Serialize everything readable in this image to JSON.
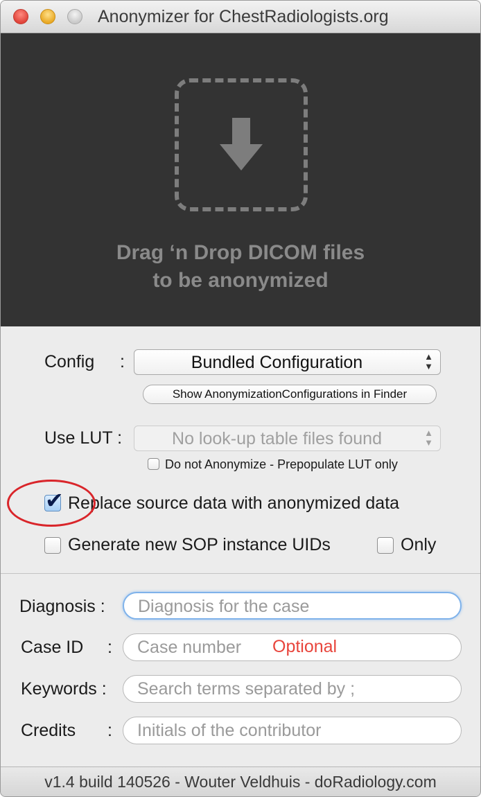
{
  "window": {
    "title": "Anonymizer for ChestRadiologists.org"
  },
  "dropzone": {
    "line1": "Drag ‘n Drop DICOM files",
    "line2": "to be anonymized",
    "icon": "download-arrow-icon"
  },
  "config": {
    "label": "Config",
    "colon": ":",
    "selected": "Bundled Configuration",
    "show_button": "Show AnonymizationConfigurations in Finder"
  },
  "lut": {
    "label": "Use LUT :",
    "selected": "No look-up table files found",
    "no_anon_label": "Do not Anonymize -  Prepopulate LUT only",
    "no_anon_checked": false
  },
  "options": {
    "replace_label": "Replace source data with anonymized data",
    "replace_checked": true,
    "generate_label": "Generate new SOP instance UIDs",
    "generate_checked": false,
    "only_label": "Only",
    "only_checked": false
  },
  "form": {
    "diagnosis": {
      "label": "Diagnosis :",
      "placeholder": "Diagnosis for the case",
      "value": ""
    },
    "case_id": {
      "label": "Case ID",
      "colon": ":",
      "placeholder": "Case number",
      "value": "",
      "hint": "Optional"
    },
    "keywords": {
      "label": "Keywords :",
      "placeholder": "Search terms separated by ;",
      "value": ""
    },
    "credits": {
      "label": "Credits",
      "colon": ":",
      "placeholder": "Initials of the contributor",
      "value": ""
    }
  },
  "status": {
    "text": "v1.4 build 140526 - Wouter Veldhuis - doRadiology.com"
  },
  "colors": {
    "annotation_circle": "#d9252a",
    "optional_hint": "#e8453c",
    "dropzone_bg": "#333333"
  }
}
